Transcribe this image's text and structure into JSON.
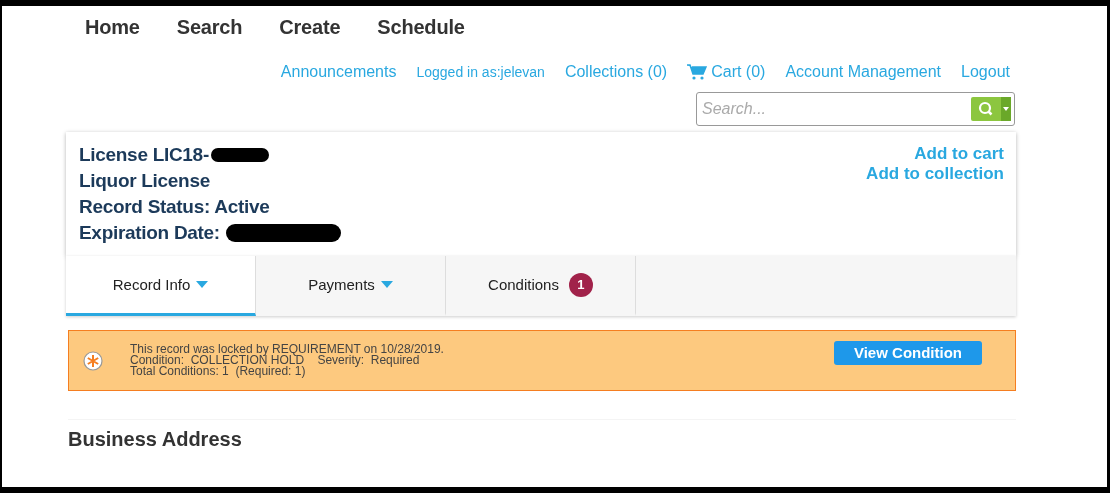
{
  "nav": {
    "items": [
      "Home",
      "Search",
      "Create",
      "Schedule"
    ]
  },
  "header_links": [
    {
      "kind": "link",
      "label": "Announcements"
    },
    {
      "kind": "user",
      "label": "Logged in as:jelevan"
    },
    {
      "kind": "link",
      "label": "Collections (0)"
    },
    {
      "kind": "cart",
      "label": "Cart (0)"
    },
    {
      "kind": "link",
      "label": "Account Management"
    },
    {
      "kind": "link",
      "label": "Logout"
    }
  ],
  "search": {
    "placeholder": "Search..."
  },
  "record": {
    "lines": [
      {
        "text": "License LIC18-",
        "redacted": true
      },
      {
        "text": "Liquor License",
        "redacted": false
      },
      {
        "text": "Record Status: Active",
        "redacted": false
      },
      {
        "text": "Expiration Date:",
        "redacted": true
      }
    ],
    "actions": [
      "Add to cart",
      "Add to collection"
    ]
  },
  "tabs": [
    {
      "label": "Record Info",
      "selected": true,
      "has_menu": true
    },
    {
      "label": "Payments",
      "selected": false,
      "has_menu": true
    },
    {
      "label": "Conditions",
      "selected": false,
      "has_menu": false,
      "badge": "1"
    }
  ],
  "condition_notice": {
    "lines": [
      "This record was locked by REQUIREMENT on 10/28/2019.",
      "Condition:  COLLECTION HOLD    Severity:  Required",
      "Total Conditions: 1  (Required: 1)"
    ],
    "button": "View Condition"
  },
  "section_title": "Business Address"
}
